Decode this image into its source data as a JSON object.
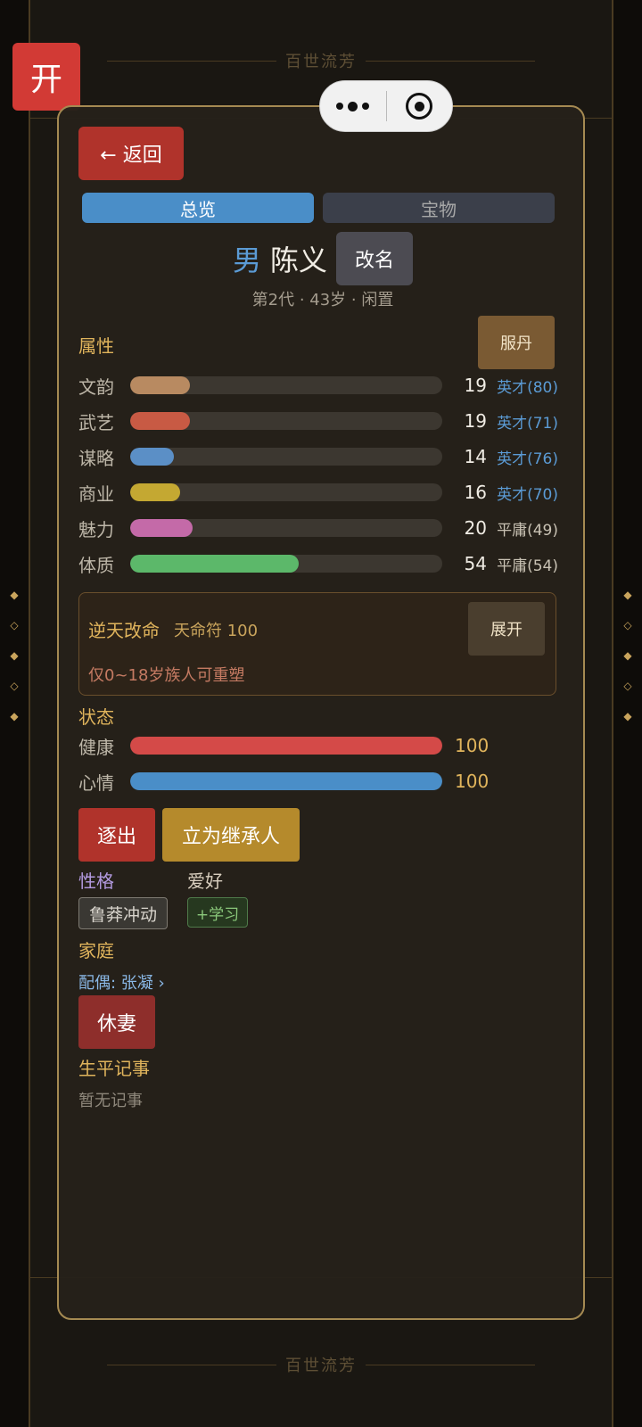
{
  "background": {
    "banner_text": "百世流芳"
  },
  "open_button": {
    "label": "开"
  },
  "panel": {
    "back_label": "← 返回",
    "tabs": [
      {
        "label": "总览",
        "active": true
      },
      {
        "label": "宝物",
        "active": false
      }
    ],
    "gender": "男",
    "name": "陈义",
    "rename_label": "改名",
    "subline": "第2代 · 43岁 · 闲置",
    "attributes_title": "属性",
    "elixir_label": "服丹",
    "attributes": [
      {
        "label": "文韵",
        "value": "19",
        "grade": "英才(80)",
        "grade_color": "blue",
        "fill_pct": 19,
        "color": "#b88a61"
      },
      {
        "label": "武艺",
        "value": "19",
        "grade": "英才(71)",
        "grade_color": "blue",
        "fill_pct": 19,
        "color": "#c85a44"
      },
      {
        "label": "谋略",
        "value": "14",
        "grade": "英才(76)",
        "grade_color": "blue",
        "fill_pct": 14,
        "color": "#5b8fc6"
      },
      {
        "label": "商业",
        "value": "16",
        "grade": "英才(70)",
        "grade_color": "blue",
        "fill_pct": 16,
        "color": "#c4a832"
      },
      {
        "label": "魅力",
        "value": "20",
        "grade": "平庸(49)",
        "grade_color": "gray",
        "fill_pct": 20,
        "color": "#c46aa8"
      },
      {
        "label": "体质",
        "value": "54",
        "grade": "平庸(54)",
        "grade_color": "gray",
        "fill_pct": 54,
        "color": "#5cb86a"
      }
    ],
    "fate": {
      "title": "逆天改命",
      "token": "天命符 100",
      "expand_label": "展开",
      "note": "仅0~18岁族人可重塑"
    },
    "status_title": "状态",
    "status": [
      {
        "label": "健康",
        "value": "100",
        "fill_pct": 100,
        "color": "#d44a48"
      },
      {
        "label": "心情",
        "value": "100",
        "fill_pct": 100,
        "color": "#4a8ec8"
      }
    ],
    "expel_label": "逐出",
    "heir_label": "立为继承人",
    "personality_title": "性格",
    "hobby_title": "爱好",
    "personality_tag": "鲁莽冲动",
    "hobby_tag": "+学习",
    "family_title": "家庭",
    "spouse_link": "配偶: 张凝 ›",
    "divorce_label": "休妻",
    "records_title": "生平记事",
    "records_empty": "暂无记事"
  },
  "colors": {
    "accent_gold": "#e0b45c",
    "danger_red": "#b0332b",
    "tab_blue": "#4a8ec8",
    "panel_border": "#a58a52"
  }
}
